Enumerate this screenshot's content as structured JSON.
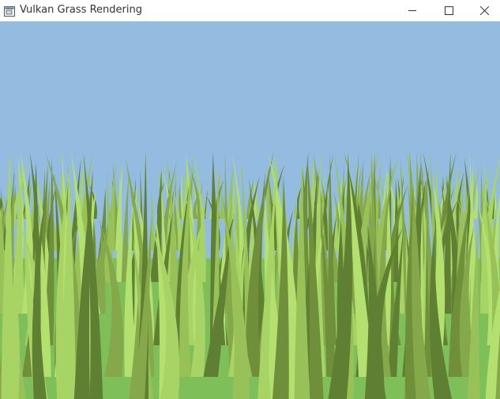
{
  "window": {
    "title": "Vulkan Grass Rendering",
    "icon": "app-window-icon",
    "controls": [
      {
        "name": "minimize",
        "icon": "minimize-icon"
      },
      {
        "name": "maximize",
        "icon": "maximize-icon"
      },
      {
        "name": "close",
        "icon": "close-icon"
      }
    ]
  },
  "scene": {
    "sky_color": "#93bce0",
    "ground_color": "#7fbf5a",
    "blade_colors": [
      "#6f8f3b",
      "#85a84a",
      "#a7d465",
      "#98c258",
      "#5f7f33",
      "#b4e070"
    ]
  }
}
